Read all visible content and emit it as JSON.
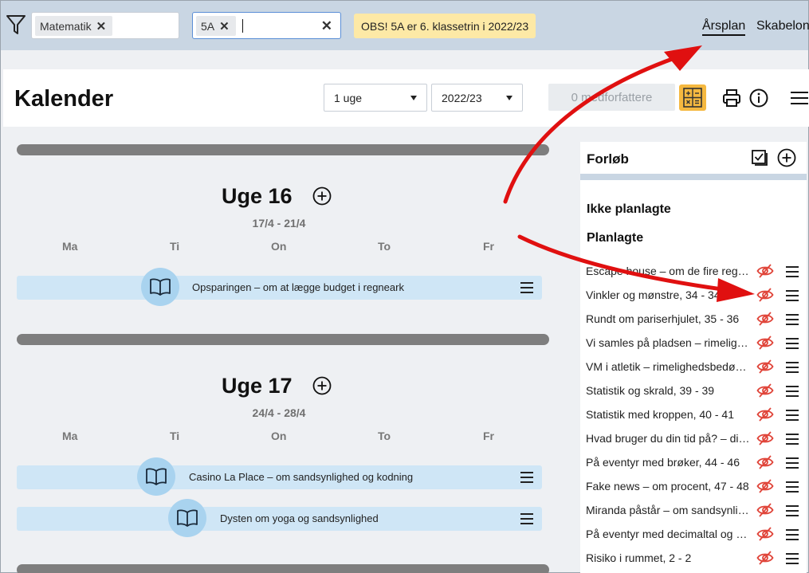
{
  "filters": {
    "subject_chip": "Matematik",
    "class_chip": "5A",
    "notice": "OBS! 5A er 6. klassetrin i 2022/23"
  },
  "nav": {
    "yearplan": "Årsplan",
    "templates": "Skabelon"
  },
  "header": {
    "title": "Kalender",
    "period_select": "1 uge",
    "year_select": "2022/23",
    "coauthors": "0 medforfattere"
  },
  "weeks": [
    {
      "title": "Uge 16",
      "range": "17/4 - 21/4",
      "days": [
        "Ma",
        "Ti",
        "On",
        "To",
        "Fr"
      ],
      "events": [
        "Opsparingen – om at lægge budget i regneark"
      ]
    },
    {
      "title": "Uge 17",
      "range": "24/4 - 28/4",
      "days": [
        "Ma",
        "Ti",
        "On",
        "To",
        "Fr"
      ],
      "events": [
        "Casino La Place – om sandsynlighed og kodning",
        "Dysten om yoga og sandsynlighed"
      ]
    }
  ],
  "panel": {
    "title": "Forløb",
    "unplanned": "Ikke planlagte",
    "planned": "Planlagte",
    "courses": [
      "Escape house – om de fire regningsarter",
      "Vinkler og mønstre, 34 - 34",
      "Rundt om pariserhjulet, 35 - 36",
      "Vi samles på pladsen – rimelighedsbedømmelse",
      "VM i atletik – rimelighedsbedømmelse",
      "Statistik og skrald, 39 - 39",
      "Statistik med kroppen, 40 - 41",
      "Hvad bruger du din tid på? – diagrammer",
      "På eventyr med brøker, 44 - 46",
      "Fake news – om procent, 47 - 48",
      "Miranda påstår – om sandsynlighed",
      "På eventyr med decimaltal og procent",
      "Risiko i rummet, 2 - 2"
    ]
  },
  "colors": {
    "accent_bar": "#c9d6e3",
    "event_bg": "#cfe6f6",
    "event_icon_bg": "#a9d3ef",
    "notice_bg": "#fde9a6",
    "calc_button": "#f5b840",
    "eye_icon": "#e0453a",
    "arrow": "#e01010"
  },
  "icons": [
    "filter-icon",
    "close-icon",
    "calculator-icon",
    "print-icon",
    "info-icon",
    "hamburger-icon",
    "checklist-icon",
    "plus-circle-icon",
    "book-icon",
    "eye-slash-icon"
  ]
}
